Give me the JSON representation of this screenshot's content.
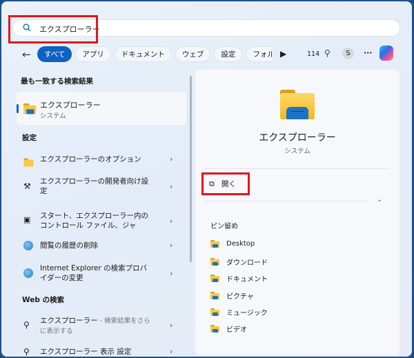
{
  "search": {
    "value": "エクスプローラー"
  },
  "tabs": [
    "すべて",
    "アプリ",
    "ドキュメント",
    "ウェブ",
    "設定",
    "フォル"
  ],
  "toolbar": {
    "points": "114",
    "avatar": "S",
    "more": "···"
  },
  "best_match": {
    "header": "最も一致する検索結果",
    "title": "エクスプローラー",
    "subtitle": "システム"
  },
  "settings": {
    "header": "設定",
    "items": [
      {
        "label": "エクスプローラーのオプション"
      },
      {
        "label": "エクスプローラーの開発者向け設定"
      },
      {
        "label": "スタート、エクスプローラー内のコントロール ファイル、ジャ"
      },
      {
        "label": "閲覧の履歴の削除"
      },
      {
        "label": "Internet Explorer の検索プロバイダーの変更"
      }
    ]
  },
  "web": {
    "header": "Web の検索",
    "items": [
      {
        "label": "エクスプローラー",
        "suffix": " - 検索結果をさらに表示する"
      },
      {
        "label": "エクスプローラー 表示 設定"
      }
    ]
  },
  "detail": {
    "title": "エクスプローラー",
    "subtitle": "システム",
    "open_label": "開く",
    "pinned_header": "ピン留め",
    "pinned": [
      "Desktop",
      "ダウンロード",
      "ドキュメント",
      "ピクチャ",
      "ミュージック",
      "ビデオ"
    ]
  },
  "colors": {
    "accent": "#0e62c4",
    "highlight": "#e3141c"
  }
}
